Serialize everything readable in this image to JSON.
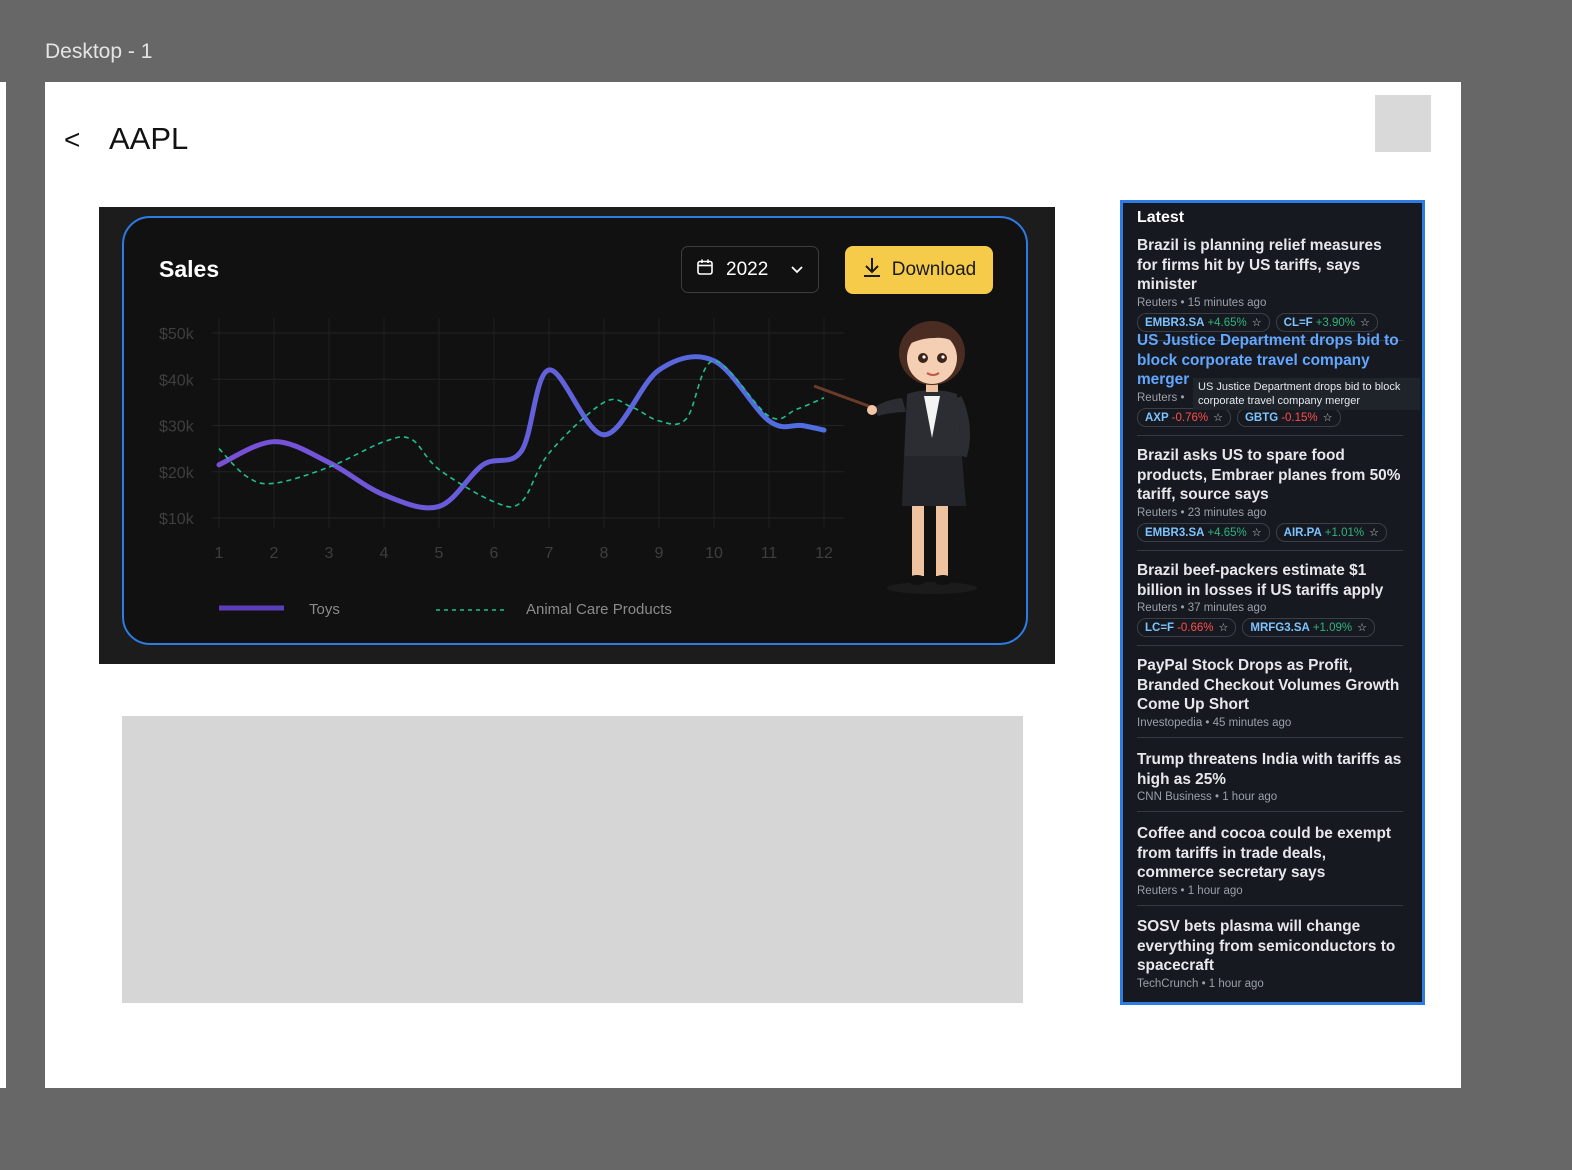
{
  "frame": {
    "label": "Desktop - 1"
  },
  "header": {
    "back_label": "<",
    "ticker": "AAPL"
  },
  "chart_card": {
    "title": "Sales",
    "year": "2022",
    "download_label": "Download",
    "icons": [
      "calendar-icon",
      "chevron-down-icon",
      "download-icon"
    ],
    "colors": {
      "toys": "#6a4fd8",
      "animal_care": "#1fbf8f",
      "download_bg": "#f6cb4a",
      "border": "#2d7be5"
    }
  },
  "chart_data": {
    "type": "line",
    "title": "Sales",
    "xlabel": "",
    "ylabel": "",
    "x": [
      1,
      2,
      3,
      4,
      5,
      6,
      7,
      8,
      9,
      10,
      11,
      12
    ],
    "x_tick_labels": [
      "1",
      "2",
      "3",
      "4",
      "5",
      "6",
      "7",
      "8",
      "9",
      "10",
      "11",
      "12"
    ],
    "y_tick_labels": [
      "$50k",
      "$40k",
      "$30k",
      "$20k",
      "$10k"
    ],
    "y_ticks": [
      50000,
      40000,
      30000,
      20000,
      10000
    ],
    "ylim": [
      10000,
      50000
    ],
    "grid": true,
    "legend_position": "bottom",
    "series": [
      {
        "name": "Toys",
        "style": "solid",
        "x": [
          1,
          2,
          3,
          4,
          5,
          5.8,
          6.5,
          7,
          8,
          9,
          10,
          11,
          11.6,
          12
        ],
        "values": [
          21500,
          26500,
          22000,
          15000,
          12500,
          21500,
          24500,
          42000,
          28000,
          42000,
          44000,
          31000,
          30000,
          29000
        ]
      },
      {
        "name": "Animal Care Products",
        "style": "dashed",
        "x": [
          1,
          1.5,
          2,
          3,
          4,
          4.5,
          5,
          6,
          6.5,
          7,
          8,
          8.5,
          9,
          9.5,
          10,
          11,
          11.5,
          12
        ],
        "values": [
          25000,
          19000,
          17500,
          21000,
          26500,
          27000,
          20500,
          13500,
          13500,
          24000,
          35000,
          34000,
          31000,
          31500,
          44000,
          32000,
          33500,
          36000
        ]
      }
    ]
  },
  "news": {
    "heading": "Latest",
    "tooltip": "US Justice Department drops bid to block corporate travel company merger",
    "items": [
      {
        "title": "Brazil is planning relief measures for firms hit by US tariffs, says minister",
        "source": "Reuters",
        "time": "15 minutes ago",
        "tags": [
          {
            "symbol": "EMBR3.SA",
            "change": "+4.65%",
            "dir": "up"
          },
          {
            "symbol": "CL=F",
            "change": "+3.90%",
            "dir": "up"
          }
        ]
      },
      {
        "title": "US Justice Department drops bid to block corporate travel company merger",
        "source": "Reuters",
        "time": "",
        "active": true,
        "tags": [
          {
            "symbol": "AXP",
            "change": "-0.76%",
            "dir": "down"
          },
          {
            "symbol": "GBTG",
            "change": "-0.15%",
            "dir": "down"
          }
        ]
      },
      {
        "title": "Brazil asks US to spare food products, Embraer planes from 50% tariff, source says",
        "source": "Reuters",
        "time": "23 minutes ago",
        "tags": [
          {
            "symbol": "EMBR3.SA",
            "change": "+4.65%",
            "dir": "up"
          },
          {
            "symbol": "AIR.PA",
            "change": "+1.01%",
            "dir": "up"
          }
        ]
      },
      {
        "title": "Brazil beef-packers estimate $1 billion in losses if US tariffs apply",
        "source": "Reuters",
        "time": "37 minutes ago",
        "tags": [
          {
            "symbol": "LC=F",
            "change": "-0.66%",
            "dir": "down"
          },
          {
            "symbol": "MRFG3.SA",
            "change": "+1.09%",
            "dir": "up"
          }
        ]
      },
      {
        "title": "PayPal Stock Drops as Profit, Branded Checkout Volumes Growth Come Up Short",
        "source": "Investopedia",
        "time": "45 minutes ago",
        "tags": []
      },
      {
        "title": "Trump threatens India with tariffs as high as 25%",
        "source": "CNN Business",
        "time": "1 hour ago",
        "tags": []
      },
      {
        "title": "Coffee and cocoa could be exempt from tariffs in trade deals, commerce secretary says",
        "source": "Reuters",
        "time": "1 hour ago",
        "tags": []
      },
      {
        "title": "SOSV bets plasma will change everything from semiconductors to spacecraft",
        "source": "TechCrunch",
        "time": "1 hour ago",
        "tags": []
      }
    ]
  }
}
